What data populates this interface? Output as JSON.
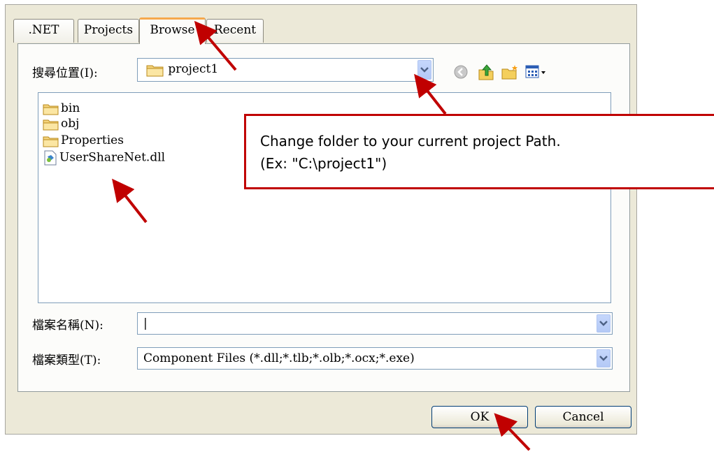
{
  "tabs": [
    {
      "label": ".NET",
      "active": false
    },
    {
      "label": "Projects",
      "active": false
    },
    {
      "label": "Browse",
      "active": true
    },
    {
      "label": "Recent",
      "active": false
    }
  ],
  "look_in": {
    "label": "搜尋位置(I):",
    "value": "project1"
  },
  "files": [
    {
      "name": "bin",
      "icon": "folder-icon"
    },
    {
      "name": "obj",
      "icon": "folder-icon"
    },
    {
      "name": "Properties",
      "icon": "folder-icon"
    },
    {
      "name": "UserShareNet.dll",
      "icon": "dll-file-icon"
    }
  ],
  "file_name": {
    "label": "檔案名稱(N):",
    "value": "|"
  },
  "file_type": {
    "label": "檔案類型(T):",
    "value": "Component Files (*.dll;*.tlb;*.olb;*.ocx;*.exe)"
  },
  "buttons": {
    "ok": "OK",
    "cancel": "Cancel"
  },
  "callout": {
    "line1": "Change folder to your current project Path.",
    "line2": "(Ex: \"C:\\project1\")"
  },
  "colors": {
    "annotation": "#c00000",
    "tab_highlight": "#f6a84c",
    "dialog_bg": "#ece9d8"
  }
}
